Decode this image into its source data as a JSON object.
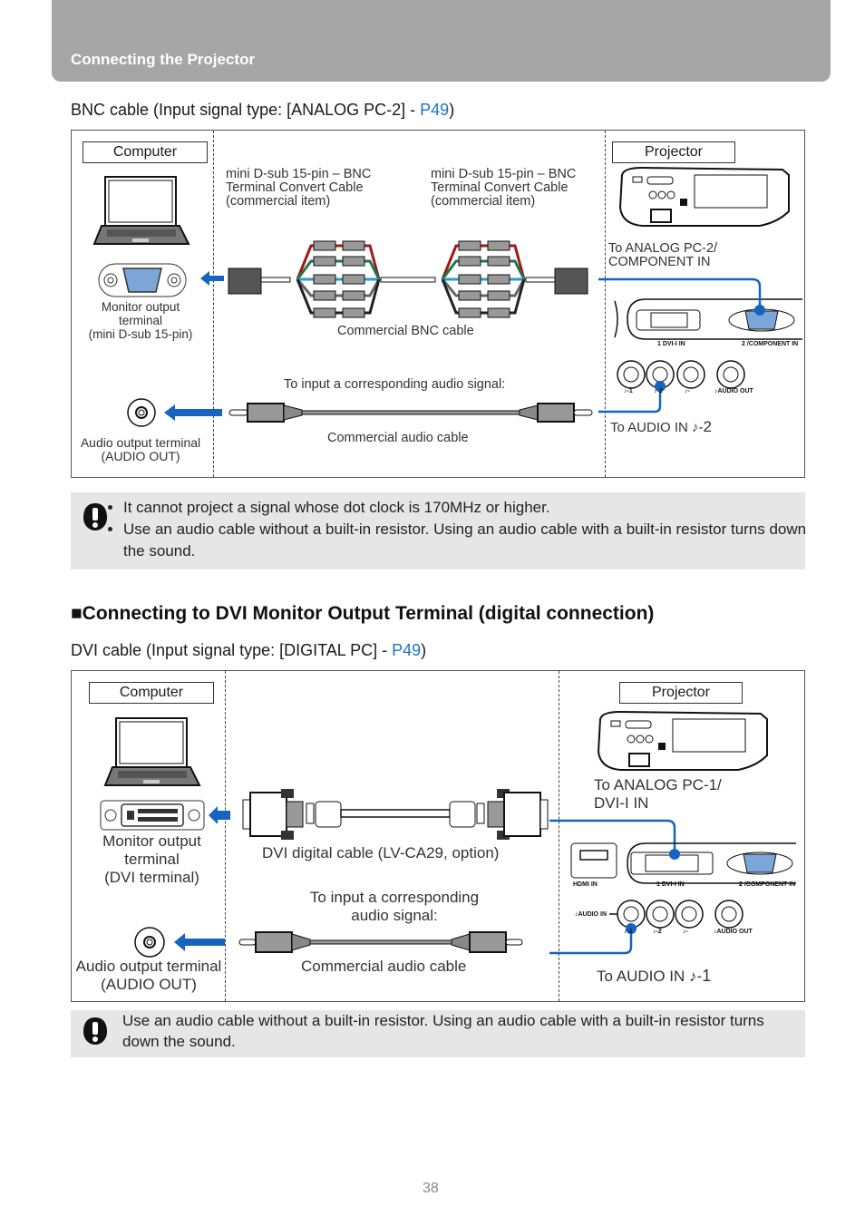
{
  "header": {
    "title": "Connecting the Projector"
  },
  "bnc_section": {
    "subtitle_prefix": "BNC cable (Input signal type: [ANALOG PC-2] - ",
    "subtitle_link": "P49",
    "subtitle_suffix": ")",
    "computer_tag": "Computer",
    "projector_tag": "Projector",
    "convert_cable_left": [
      "mini D-sub 15-pin – BNC",
      "Terminal Convert Cable",
      "(commercial item)"
    ],
    "convert_cable_right": [
      "mini D-sub 15-pin – BNC",
      "Terminal Convert Cable",
      "(commercial item)"
    ],
    "monitor_terminal": [
      "Monitor output",
      "terminal",
      "(mini D-sub 15-pin)"
    ],
    "bnc_cable_label": "Commercial BNC cable",
    "to_analog": [
      "To ANALOG PC-2/",
      "COMPONENT IN"
    ],
    "audio_prompt": "To input a corresponding audio signal:",
    "audio_cable_label": "Commercial audio cable",
    "audio_out_terminal": [
      "Audio output terminal",
      "(AUDIO OUT)"
    ],
    "to_audio_in": "To AUDIO IN ♪-",
    "to_audio_in_num": "2",
    "port_labels": {
      "dvi": "1 DVI-I IN",
      "component": "2 /COMPONENT IN",
      "a1": "♪-1",
      "a2": "♪-2",
      "a3": "♪-",
      "aout": "♪AUDIO OUT"
    }
  },
  "bnc_notes": [
    "It cannot project a signal whose dot clock is 170MHz or higher.",
    "Use an audio cable without a built-in resistor. Using an audio cable with a built-in resistor turns down the sound."
  ],
  "dvi_section": {
    "title": "■Connecting to DVI Monitor Output Terminal (digital connection)",
    "subtitle_prefix": "DVI cable (Input signal type: [DIGITAL PC] - ",
    "subtitle_link": "P49",
    "subtitle_suffix": ")",
    "computer_tag": "Computer",
    "projector_tag": "Projector",
    "monitor_terminal": [
      "Monitor output",
      "terminal",
      "(DVI terminal)"
    ],
    "dvi_cable_label": "DVI digital cable (LV-CA29, option)",
    "to_analog": [
      "To ANALOG PC-1/",
      "DVI-I IN"
    ],
    "audio_prompt": [
      "To input a corresponding",
      "audio signal:"
    ],
    "audio_cable_label": "Commercial audio cable",
    "audio_out_terminal": [
      "Audio output terminal",
      "(AUDIO OUT)"
    ],
    "to_audio_in": "To AUDIO IN ♪-",
    "to_audio_in_num": "1",
    "port_labels": {
      "hdmi": "HDMI IN",
      "dvi": "1 DVI-I IN",
      "component": "2 /COMPONENT IN",
      "audio_in": "♪AUDIO IN",
      "a1": "♪-1",
      "a2": "♪-2",
      "a3": "♪-",
      "aout": "♪AUDIO OUT"
    }
  },
  "dvi_note": "Use an audio cable without a built-in resistor. Using an audio cable with a built-in resistor turns down the sound.",
  "page_number": "38",
  "colors": {
    "accent_blue": "#1565c0",
    "link_blue": "#1a73c8",
    "header_gray": "#a6a6a6",
    "note_gray": "#e6e6e6"
  }
}
